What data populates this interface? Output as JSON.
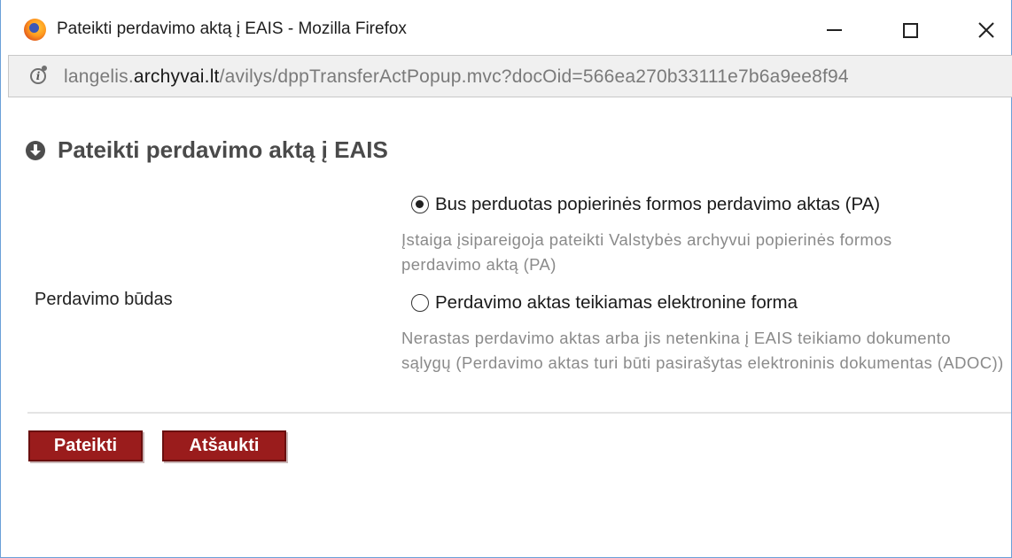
{
  "window": {
    "title": "Pateikti perdavimo aktą į EAIS - Mozilla Firefox",
    "minimize_label": "—",
    "maximize_label": "",
    "close_label": "✕"
  },
  "urlbar": {
    "prefix": "langelis.",
    "domain": "archyvai.lt",
    "path": "/avilys/dppTransferActPopup.mvc?docOid=566ea270b33111e7b6a9ee8f94"
  },
  "page": {
    "heading": "Pateikti perdavimo aktą į EAIS",
    "field_label": "Perdavimo būdas",
    "options": [
      {
        "label": "Bus perduotas popierinės formos perdavimo aktas (PA)",
        "description": "Įstaiga įsipareigoja pateikti Valstybės archyvui popierinės formos perdavimo aktą (PA)",
        "checked": true
      },
      {
        "label": "Perdavimo aktas teikiamas elektronine forma",
        "description": "Nerastas perdavimo aktas arba jis netenkina į EAIS teikiamo dokumento sąlygų (Perdavimo aktas turi būti pasirašytas elektroninis dokumentas (ADOC))",
        "checked": false
      }
    ],
    "buttons": {
      "submit": "Pateikti",
      "cancel": "Atšaukti"
    }
  },
  "colors": {
    "button_bg": "#9a1c1c",
    "window_border": "#6aa0d8",
    "description_text": "#8a8a8a"
  }
}
